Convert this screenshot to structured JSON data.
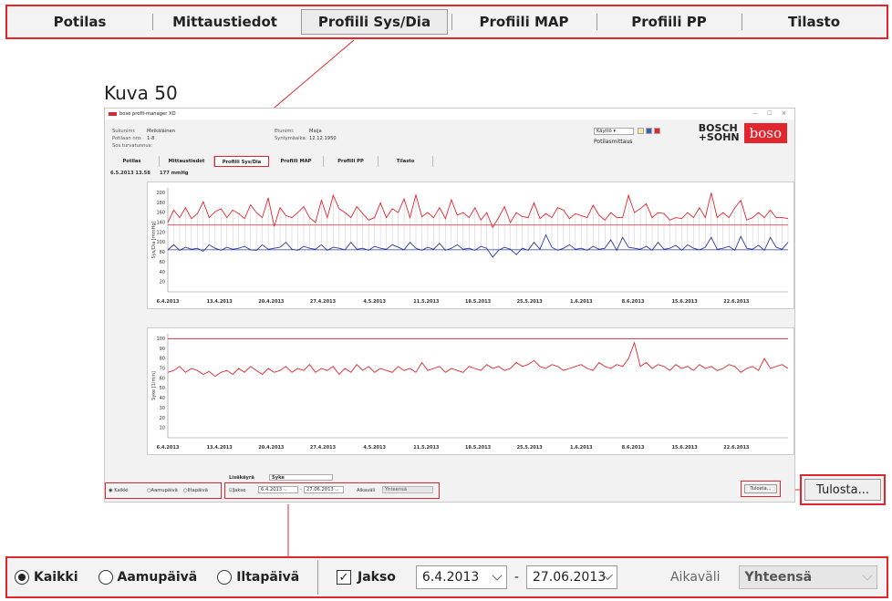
{
  "tabs": [
    "Potilas",
    "Mittaustiedot",
    "Profiili Sys/Dia",
    "Profiili MAP",
    "Profiili PP",
    "Tilasto"
  ],
  "active_tab": "Profiili Sys/Dia",
  "figure_label": "Kuva 50",
  "window": {
    "title": "boso profil-manager XD",
    "patient": {
      "sukunimi_label": "Sukunimi:",
      "sukunimi": "Meikäläinen",
      "potilaan_nro_label": "Potilaan nro:",
      "potilaan_nro": "1-8",
      "sos_label": "Sos.turvatunnus:",
      "etunimi_label": "Etunimi:",
      "etunimi": "Maija",
      "syntymaaika_label": "Syntymäaika:",
      "syntymaaika": "12.12.1950"
    },
    "user_select": "Käyttö",
    "potilasmittaus": "Potilasmittaus",
    "brand_text_1": "BOSCH",
    "brand_text_2": "+SOHN",
    "brand_logo": "boso",
    "readout_date": "6.5.2013 13.58",
    "readout_value": "177 mmHg",
    "lisakayra_label": "Lisäkäyrä",
    "lisakayra_value": "Syke",
    "small_tulosta": "Tulosta...",
    "aikavali_small": "Aikaväli",
    "yhteensa_small": "Yhteensä"
  },
  "chart_data": [
    {
      "type": "line",
      "ylabel": "Sys/Dia [mmHg]",
      "yticks": [
        20,
        40,
        60,
        80,
        100,
        120,
        140,
        160,
        180,
        200
      ],
      "xticks": [
        "6.4.2013",
        "13.4.2013",
        "20.4.2013",
        "27.4.2013",
        "4.5.2013",
        "11.5.2013",
        "18.5.2013",
        "25.5.2013",
        "1.6.2013",
        "8.6.2013",
        "15.6.2013",
        "22.6.2013"
      ],
      "ylim": [
        0,
        210
      ],
      "threshold_sys": 135,
      "threshold_dia": 85,
      "series": [
        {
          "name": "Sys",
          "color": "#e3262d",
          "values": [
            140,
            165,
            150,
            170,
            148,
            158,
            182,
            150,
            162,
            168,
            150,
            165,
            158,
            148,
            176,
            160,
            150,
            190,
            132,
            170,
            154,
            150,
            160,
            172,
            150,
            140,
            185,
            150,
            195,
            168,
            160,
            150,
            172,
            158,
            145,
            150,
            180,
            150,
            168,
            160,
            188,
            150,
            196,
            152,
            160,
            150,
            170,
            148,
            186,
            155,
            160,
            150,
            170,
            145,
            160,
            130,
            150,
            172,
            140,
            160,
            152,
            150,
            180,
            148,
            158,
            150,
            170,
            165,
            148,
            158,
            154,
            150,
            175,
            155,
            145,
            160,
            150,
            150,
            195,
            160,
            168,
            178,
            150,
            160,
            158,
            145,
            150,
            148,
            160,
            150,
            170,
            150,
            200,
            150,
            160,
            150,
            170,
            185,
            145,
            150,
            160,
            150,
            165,
            150,
            150,
            148
          ]
        },
        {
          "name": "Dia",
          "color": "#2b3a9a",
          "values": [
            85,
            95,
            84,
            90,
            86,
            88,
            82,
            95,
            88,
            84,
            90,
            86,
            88,
            92,
            85,
            84,
            95,
            86,
            88,
            90,
            100,
            86,
            84,
            92,
            88,
            86,
            95,
            84,
            90,
            88,
            85,
            100,
            86,
            88,
            84,
            92,
            88,
            86,
            95,
            90,
            85,
            100,
            88,
            84,
            90,
            86,
            98,
            84,
            88,
            95,
            86,
            88,
            84,
            92,
            88,
            70,
            84,
            90,
            86,
            75,
            88,
            84,
            100,
            86,
            115,
            90,
            84,
            88,
            95,
            86,
            88,
            84,
            92,
            86,
            88,
            105,
            84,
            110,
            90,
            88,
            86,
            92,
            84,
            100,
            86,
            88,
            94,
            84,
            95,
            88,
            85,
            90,
            110,
            86,
            88,
            92,
            84,
            112,
            88,
            86,
            94,
            84,
            110,
            90,
            86,
            100
          ]
        }
      ]
    },
    {
      "type": "line",
      "ylabel": "Syke [1/min]",
      "yticks": [
        10,
        20,
        30,
        40,
        50,
        60,
        70,
        80,
        90,
        100
      ],
      "xticks": [
        "6.4.2013",
        "13.4.2013",
        "20.4.2013",
        "27.4.2013",
        "4.5.2013",
        "11.5.2013",
        "18.5.2013",
        "25.5.2013",
        "1.6.2013",
        "8.6.2013",
        "15.6.2013",
        "22.6.2013"
      ],
      "ylim": [
        0,
        105
      ],
      "threshold": 100,
      "series": [
        {
          "name": "Syke",
          "color": "#e3262d",
          "values": [
            66,
            68,
            72,
            66,
            70,
            68,
            64,
            67,
            62,
            66,
            68,
            64,
            70,
            66,
            72,
            68,
            64,
            70,
            66,
            68,
            72,
            66,
            70,
            68,
            74,
            66,
            70,
            68,
            72,
            64,
            70,
            66,
            74,
            68,
            72,
            66,
            70,
            68,
            66,
            72,
            68,
            70,
            66,
            76,
            68,
            70,
            72,
            66,
            70,
            68,
            66,
            72,
            70,
            68,
            74,
            70,
            72,
            68,
            70,
            76,
            72,
            74,
            78,
            72,
            70,
            74,
            72,
            68,
            70,
            72,
            74,
            70,
            68,
            76,
            72,
            70,
            74,
            72,
            80,
            96,
            72,
            76,
            70,
            74,
            72,
            68,
            74,
            70,
            72,
            68,
            74,
            70,
            72,
            68,
            70,
            74,
            72,
            66,
            70,
            72,
            68,
            80,
            70,
            72,
            74,
            70
          ]
        }
      ]
    }
  ],
  "filters": {
    "kaikki": "Kaikki",
    "aamupaiva": "Aamupäivä",
    "iltapaiva": "Iltapäivä",
    "selected": "Kaikki",
    "jakso_label": "Jakso",
    "jakso_checked": true,
    "start_date": "6.4.2013",
    "end_date": "27.06.2013",
    "separator": "-",
    "aikavali_label": "Aikaväli",
    "aikavali_value": "Yhteensä"
  },
  "tulosta_label": "Tulosta..."
}
